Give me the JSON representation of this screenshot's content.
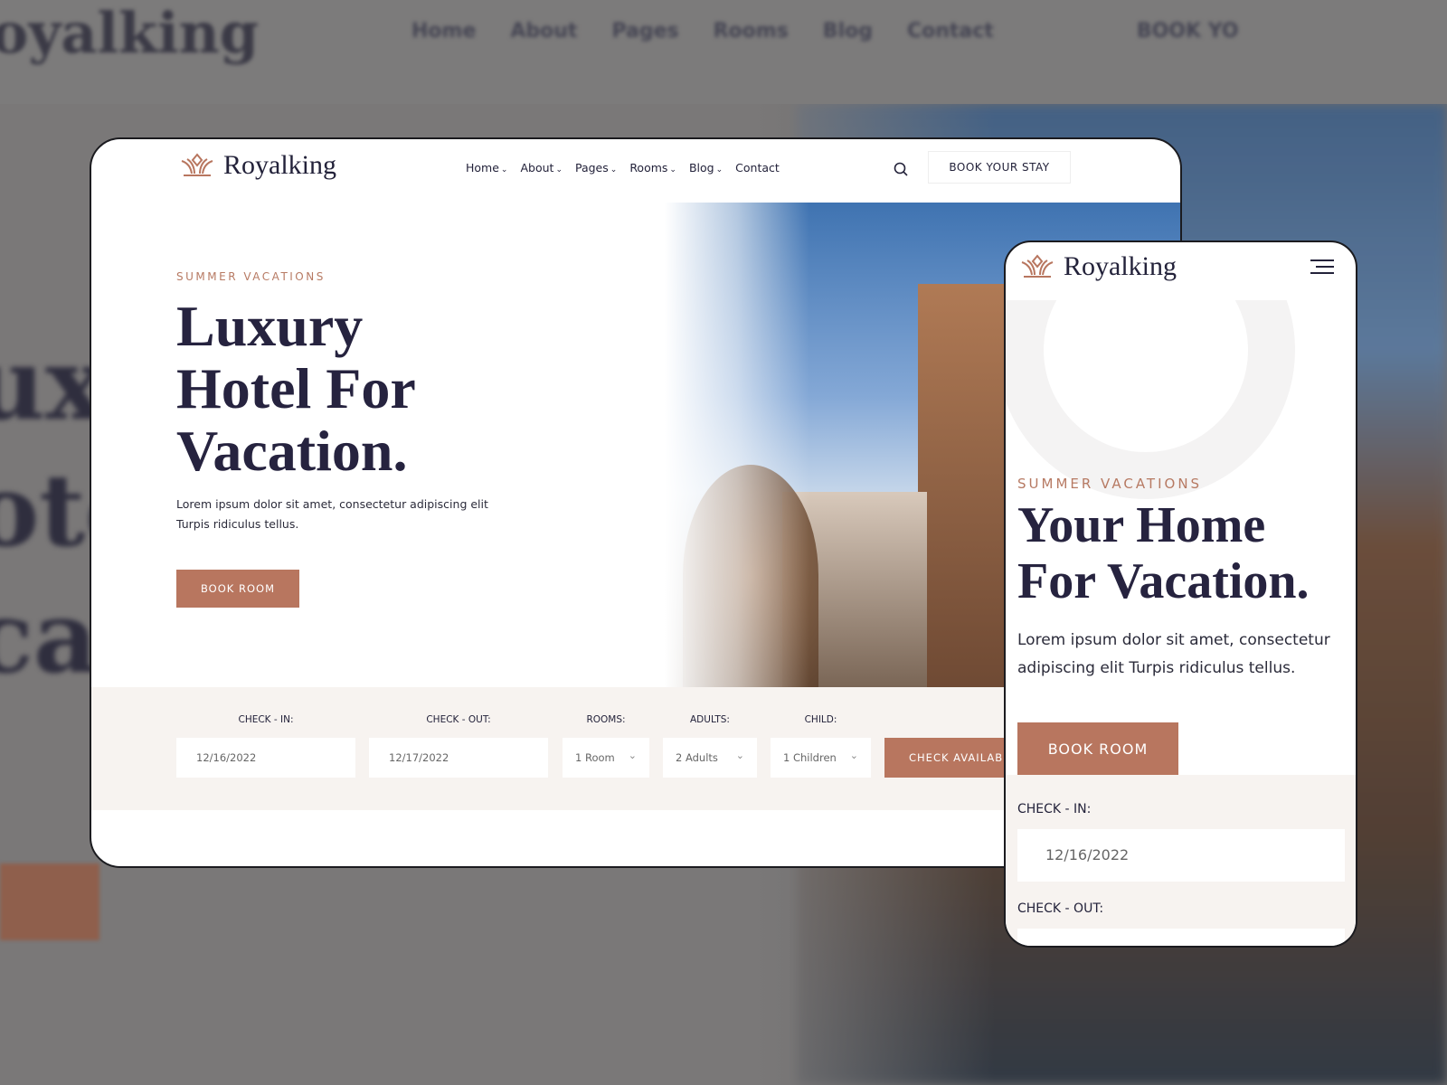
{
  "brand": "Royalking",
  "colors": {
    "accent": "#b8765f",
    "heading": "#26233f",
    "strip": "#f7f3f0"
  },
  "nav": {
    "items": [
      {
        "label": "Home",
        "icon": "chevron-down-icon"
      },
      {
        "label": "About",
        "icon": "chevron-down-icon"
      },
      {
        "label": "Pages",
        "icon": "chevron-down-icon"
      },
      {
        "label": "Rooms",
        "icon": "chevron-down-icon"
      },
      {
        "label": "Blog",
        "icon": "chevron-down-icon"
      },
      {
        "label": "Contact"
      }
    ],
    "cta": "BOOK YOUR STAY",
    "search_icon": "search-icon"
  },
  "desktop": {
    "eyebrow": "SUMMER VACATIONS",
    "title_lines": [
      "Luxury",
      "Hotel For",
      "Vacation."
    ],
    "text_lines": [
      "Lorem ipsum dolor sit amet, consectetur adipiscing elit",
      "Turpis ridiculus tellus."
    ],
    "button": "BOOK ROOM"
  },
  "booking": {
    "check_in_label": "CHECK - IN:",
    "check_in": "12/16/2022",
    "check_out_label": "CHECK - OUT:",
    "check_out": "12/17/2022",
    "rooms_label": "ROOMS:",
    "rooms": "1 Room",
    "adults_label": "ADULTS:",
    "adults": "2 Adults",
    "child_label": "CHILD:",
    "child": "1 Children",
    "button": "CHECK AVAILABILITY"
  },
  "mobile": {
    "eyebrow": "SUMMER VACATIONS",
    "title_lines": [
      "Your Home",
      "For Vacation."
    ],
    "text_lines": [
      "Lorem ipsum dolor sit amet, consectetur",
      "adipiscing elit Turpis ridiculus tellus."
    ],
    "button": "BOOK ROOM",
    "check_in_label": "CHECK - IN:",
    "check_in": "12/16/2022",
    "check_out_label": "CHECK - OUT:",
    "menu_icon": "hamburger-icon"
  },
  "background": {
    "logo": "oyalking",
    "nav": [
      "Home",
      "About",
      "Pages",
      "Rooms",
      "Blog",
      "Contact"
    ],
    "big": [
      "uxu",
      "ote",
      "ca"
    ],
    "cta": "BOOK YO"
  }
}
